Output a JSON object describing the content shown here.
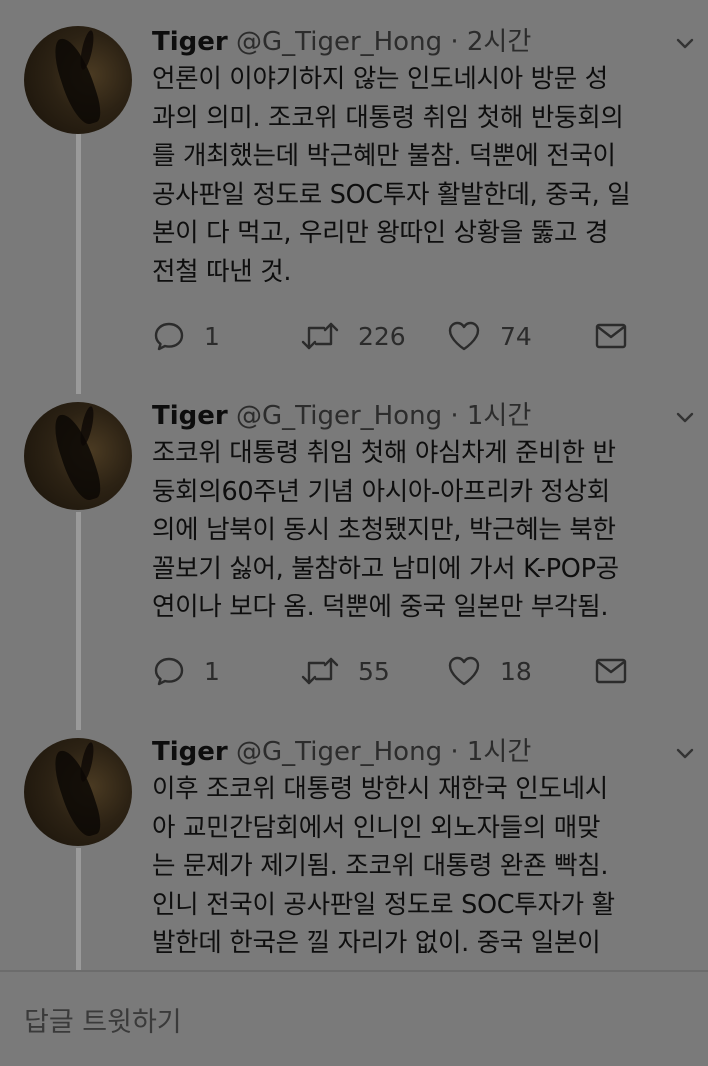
{
  "tweets": [
    {
      "name": "Tiger",
      "handle": "@G_Tiger_Hong",
      "dot": "·",
      "time": "2시간",
      "lines": [
        "언론이 이야기하지 않는 인도네시아 방문 성",
        "과의 의미. 조코위 대통령 취임 첫해 반둥회의",
        "를 개최했는데 박근혜만 불참. 덕뿐에 전국이",
        "공사판일 정도로 SOC투자 활발한데, 중국, 일",
        "본이 다 먹고, 우리만 왕따인 상황을 뚫고 경",
        "전철 따낸 것."
      ],
      "reply_count": "1",
      "retweet_count": "226",
      "like_count": "74"
    },
    {
      "name": "Tiger",
      "handle": "@G_Tiger_Hong",
      "dot": "·",
      "time": "1시간",
      "lines": [
        "조코위 대통령 취임 첫해 야심차게 준비한 반",
        "둥회의60주년 기념 아시아-아프리카 정상회",
        "의에 남북이 동시 초청됐지만, 박근혜는 북한",
        "꼴보기 싫어, 불참하고 남미에 가서 K-POP공",
        "연이나 보다 옴. 덕뿐에 중국 일본만 부각됨."
      ],
      "reply_count": "1",
      "retweet_count": "55",
      "like_count": "18"
    },
    {
      "name": "Tiger",
      "handle": "@G_Tiger_Hong",
      "dot": "·",
      "time": "1시간",
      "lines": [
        "이후 조코위 대통령 방한시 재한국 인도네시",
        "아 교민간담회에서 인니인 외노자들의 매맞",
        "는 문제가 제기됨. 조코위 대통령 완죤 빡침.",
        "인니 전국이 공사판일 정도로 SOC투자가 활",
        "발한데 한국은 낄 자리가 없이. 중국 일본이"
      ]
    }
  ],
  "reply_bar": {
    "placeholder": "답글 트윗하기"
  },
  "icons": {
    "reply": "reply-icon",
    "retweet": "retweet-icon",
    "like": "heart-icon",
    "dm": "envelope-icon",
    "menu": "chevron-down-icon"
  }
}
